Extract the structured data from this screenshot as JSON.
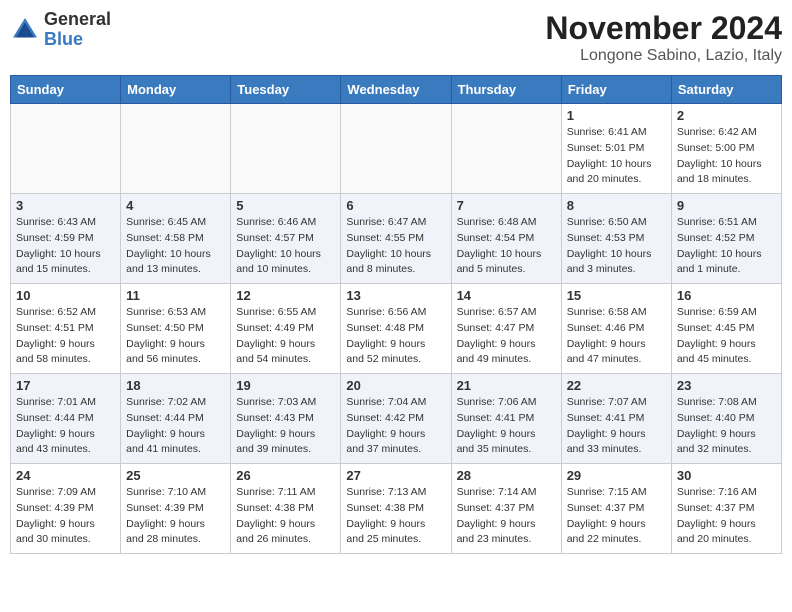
{
  "header": {
    "logo_line1": "General",
    "logo_line2": "Blue",
    "month_title": "November 2024",
    "location": "Longone Sabino, Lazio, Italy"
  },
  "weekdays": [
    "Sunday",
    "Monday",
    "Tuesday",
    "Wednesday",
    "Thursday",
    "Friday",
    "Saturday"
  ],
  "weeks": [
    [
      {
        "day": "",
        "info": ""
      },
      {
        "day": "",
        "info": ""
      },
      {
        "day": "",
        "info": ""
      },
      {
        "day": "",
        "info": ""
      },
      {
        "day": "",
        "info": ""
      },
      {
        "day": "1",
        "info": "Sunrise: 6:41 AM\nSunset: 5:01 PM\nDaylight: 10 hours and 20 minutes."
      },
      {
        "day": "2",
        "info": "Sunrise: 6:42 AM\nSunset: 5:00 PM\nDaylight: 10 hours and 18 minutes."
      }
    ],
    [
      {
        "day": "3",
        "info": "Sunrise: 6:43 AM\nSunset: 4:59 PM\nDaylight: 10 hours and 15 minutes."
      },
      {
        "day": "4",
        "info": "Sunrise: 6:45 AM\nSunset: 4:58 PM\nDaylight: 10 hours and 13 minutes."
      },
      {
        "day": "5",
        "info": "Sunrise: 6:46 AM\nSunset: 4:57 PM\nDaylight: 10 hours and 10 minutes."
      },
      {
        "day": "6",
        "info": "Sunrise: 6:47 AM\nSunset: 4:55 PM\nDaylight: 10 hours and 8 minutes."
      },
      {
        "day": "7",
        "info": "Sunrise: 6:48 AM\nSunset: 4:54 PM\nDaylight: 10 hours and 5 minutes."
      },
      {
        "day": "8",
        "info": "Sunrise: 6:50 AM\nSunset: 4:53 PM\nDaylight: 10 hours and 3 minutes."
      },
      {
        "day": "9",
        "info": "Sunrise: 6:51 AM\nSunset: 4:52 PM\nDaylight: 10 hours and 1 minute."
      }
    ],
    [
      {
        "day": "10",
        "info": "Sunrise: 6:52 AM\nSunset: 4:51 PM\nDaylight: 9 hours and 58 minutes."
      },
      {
        "day": "11",
        "info": "Sunrise: 6:53 AM\nSunset: 4:50 PM\nDaylight: 9 hours and 56 minutes."
      },
      {
        "day": "12",
        "info": "Sunrise: 6:55 AM\nSunset: 4:49 PM\nDaylight: 9 hours and 54 minutes."
      },
      {
        "day": "13",
        "info": "Sunrise: 6:56 AM\nSunset: 4:48 PM\nDaylight: 9 hours and 52 minutes."
      },
      {
        "day": "14",
        "info": "Sunrise: 6:57 AM\nSunset: 4:47 PM\nDaylight: 9 hours and 49 minutes."
      },
      {
        "day": "15",
        "info": "Sunrise: 6:58 AM\nSunset: 4:46 PM\nDaylight: 9 hours and 47 minutes."
      },
      {
        "day": "16",
        "info": "Sunrise: 6:59 AM\nSunset: 4:45 PM\nDaylight: 9 hours and 45 minutes."
      }
    ],
    [
      {
        "day": "17",
        "info": "Sunrise: 7:01 AM\nSunset: 4:44 PM\nDaylight: 9 hours and 43 minutes."
      },
      {
        "day": "18",
        "info": "Sunrise: 7:02 AM\nSunset: 4:44 PM\nDaylight: 9 hours and 41 minutes."
      },
      {
        "day": "19",
        "info": "Sunrise: 7:03 AM\nSunset: 4:43 PM\nDaylight: 9 hours and 39 minutes."
      },
      {
        "day": "20",
        "info": "Sunrise: 7:04 AM\nSunset: 4:42 PM\nDaylight: 9 hours and 37 minutes."
      },
      {
        "day": "21",
        "info": "Sunrise: 7:06 AM\nSunset: 4:41 PM\nDaylight: 9 hours and 35 minutes."
      },
      {
        "day": "22",
        "info": "Sunrise: 7:07 AM\nSunset: 4:41 PM\nDaylight: 9 hours and 33 minutes."
      },
      {
        "day": "23",
        "info": "Sunrise: 7:08 AM\nSunset: 4:40 PM\nDaylight: 9 hours and 32 minutes."
      }
    ],
    [
      {
        "day": "24",
        "info": "Sunrise: 7:09 AM\nSunset: 4:39 PM\nDaylight: 9 hours and 30 minutes."
      },
      {
        "day": "25",
        "info": "Sunrise: 7:10 AM\nSunset: 4:39 PM\nDaylight: 9 hours and 28 minutes."
      },
      {
        "day": "26",
        "info": "Sunrise: 7:11 AM\nSunset: 4:38 PM\nDaylight: 9 hours and 26 minutes."
      },
      {
        "day": "27",
        "info": "Sunrise: 7:13 AM\nSunset: 4:38 PM\nDaylight: 9 hours and 25 minutes."
      },
      {
        "day": "28",
        "info": "Sunrise: 7:14 AM\nSunset: 4:37 PM\nDaylight: 9 hours and 23 minutes."
      },
      {
        "day": "29",
        "info": "Sunrise: 7:15 AM\nSunset: 4:37 PM\nDaylight: 9 hours and 22 minutes."
      },
      {
        "day": "30",
        "info": "Sunrise: 7:16 AM\nSunset: 4:37 PM\nDaylight: 9 hours and 20 minutes."
      }
    ]
  ]
}
